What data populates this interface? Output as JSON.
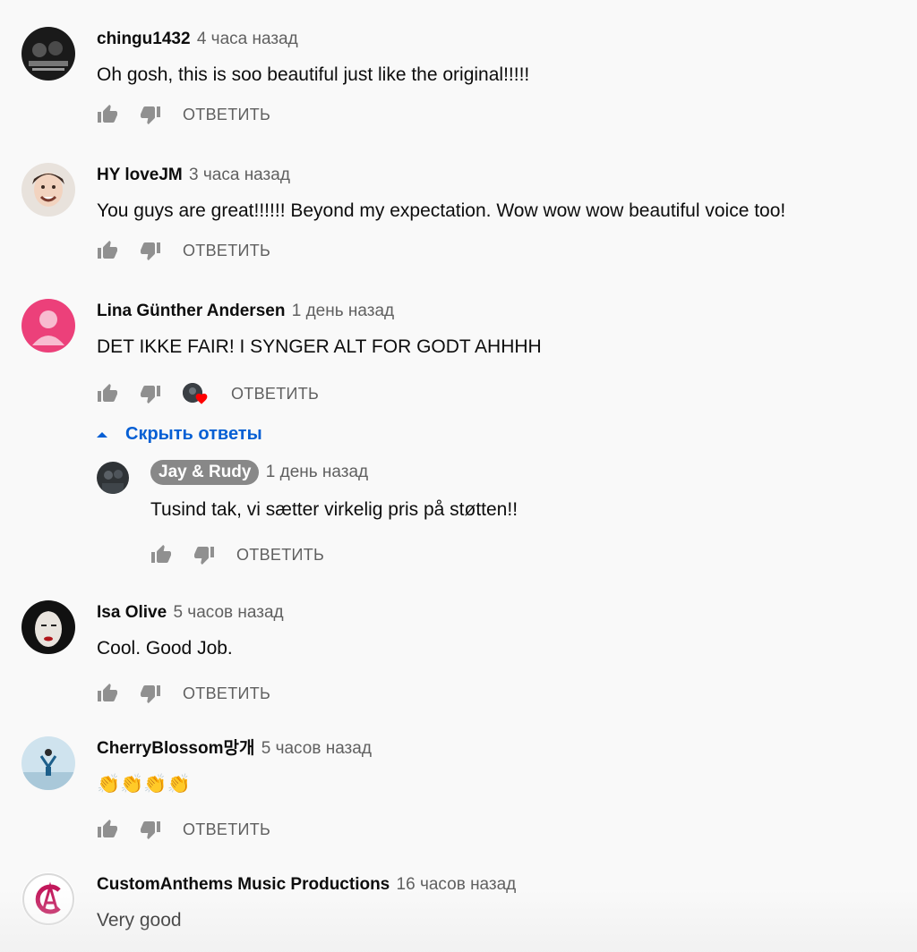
{
  "reply_label": "ОТВЕТИТЬ",
  "comments": [
    {
      "author": "chingu1432",
      "time": "4 часа назад",
      "text": "Oh gosh, this is soo beautiful just like the original!!!!!"
    },
    {
      "author": "HY loveJM",
      "time": "3 часа назад",
      "text": "You guys are great!!!!!! Beyond my expectation. Wow wow wow beautiful voice too!"
    },
    {
      "author": "Lina Günther Andersen",
      "time": "1 день назад",
      "text": "DET IKKE FAIR! I SYNGER ALT FOR GODT AHHHH",
      "hide_replies": "Скрыть ответы",
      "reply": {
        "author": "Jay & Rudy",
        "time": "1 день назад",
        "text": "Tusind tak, vi sætter virkelig pris på støtten!!"
      }
    },
    {
      "author": "Isa Olive",
      "time": "5 часов назад",
      "text": "Cool. Good Job."
    },
    {
      "author": "CherryBlossom망개",
      "time": "5 часов назад",
      "text": "👏👏👏👏"
    },
    {
      "author": "CustomAnthems Music Productions",
      "time": "16 часов назад",
      "text": "Very good"
    }
  ],
  "colors": {
    "link_blue": "#065fd4",
    "muted": "#606060",
    "owner_badge": "#888888",
    "heart": "#ff0000"
  }
}
